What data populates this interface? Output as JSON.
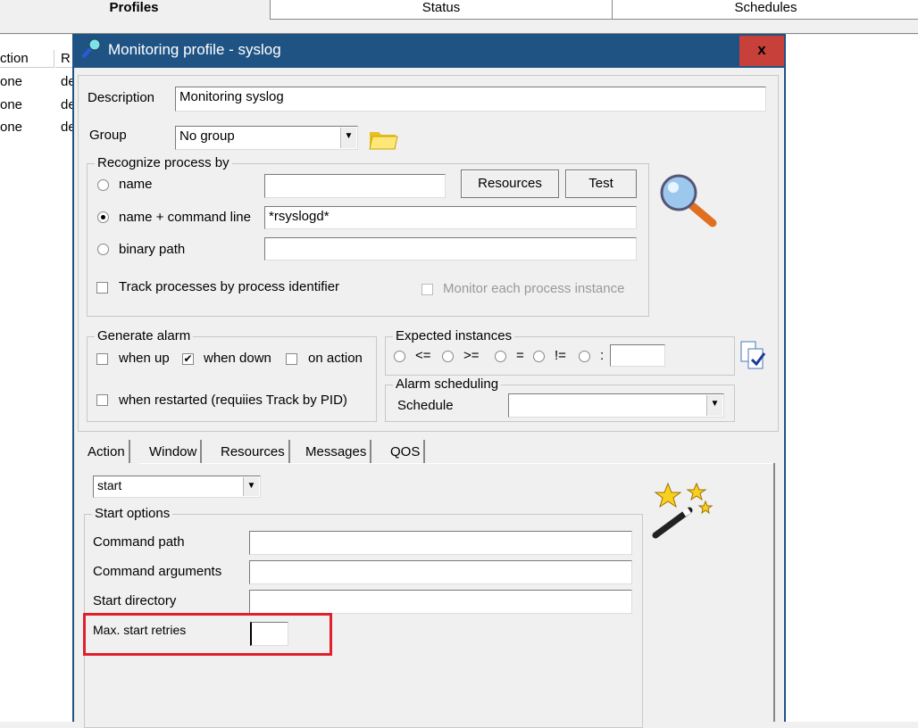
{
  "app": {
    "tabs": [
      "Profiles",
      "Status",
      "Schedules"
    ],
    "list_headers": [
      "ction",
      "R"
    ],
    "list_rows": [
      [
        "one",
        "de"
      ],
      [
        "one",
        "de"
      ],
      [
        "one",
        "de"
      ]
    ]
  },
  "dialog": {
    "title": "Monitoring profile - syslog",
    "close": "x",
    "description_label": "Description",
    "description_value": "Monitoring syslog",
    "group_label": "Group",
    "group_value": "No group",
    "recognize": {
      "legend": "Recognize process by",
      "options": [
        "name",
        "name + command line",
        "binary path"
      ],
      "selected": 1,
      "name_value": "",
      "cmdline_value": "*rsyslogd*",
      "binary_value": "",
      "resources_btn": "Resources",
      "test_btn": "Test",
      "track_pid": "Track processes by process identifier",
      "track_pid_checked": false,
      "monitor_each": "Monitor each process instance",
      "monitor_each_checked": false
    },
    "alarm": {
      "legend": "Generate alarm",
      "when_up": "when up",
      "when_up_checked": false,
      "when_down": "when down",
      "when_down_checked": true,
      "on_action": "on action",
      "on_action_checked": false,
      "when_restarted": "when restarted (requiies Track by PID)",
      "when_restarted_checked": false
    },
    "expected": {
      "legend": "Expected instances",
      "ops": [
        "<=",
        ">=",
        "=",
        "!=",
        ":"
      ],
      "value": ""
    },
    "scheduling": {
      "legend": "Alarm scheduling",
      "schedule_label": "Schedule",
      "schedule_value": ""
    },
    "tabs": [
      "Action",
      "Window",
      "Resources",
      "Messages",
      "QOS"
    ],
    "action": {
      "select_value": "start",
      "start_legend": "Start options",
      "command_path": "Command path",
      "command_args": "Command arguments",
      "start_dir": "Start directory",
      "max_retries": "Max. start retries",
      "command_path_value": "",
      "command_args_value": "",
      "start_dir_value": "",
      "max_retries_value": ""
    },
    "highlight_color": "#e0202a",
    "titlebar_color": "#1f5384"
  }
}
